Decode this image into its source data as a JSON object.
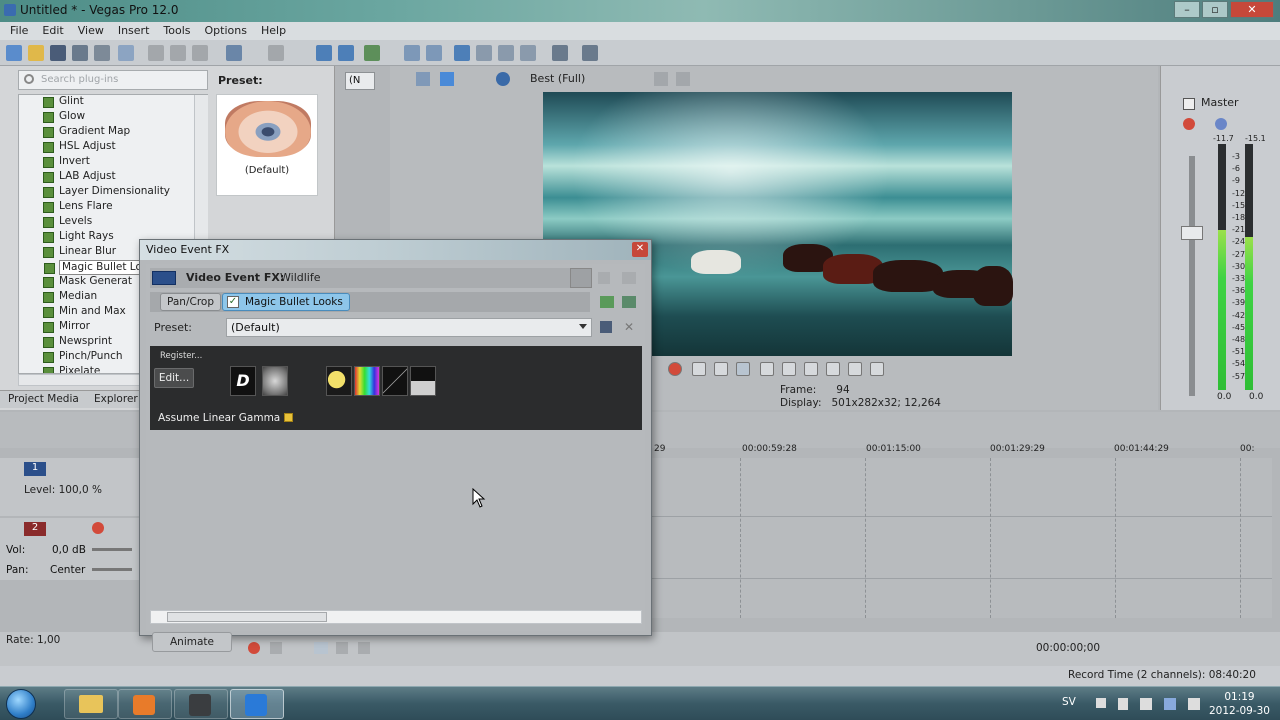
{
  "window": {
    "title": "Untitled * - Vegas Pro 12.0"
  },
  "menu": [
    "File",
    "Edit",
    "View",
    "Insert",
    "Tools",
    "Options",
    "Help"
  ],
  "plugins": {
    "search_placeholder": "Search plug-ins",
    "items": [
      "Glint",
      "Glow",
      "Gradient Map",
      "HSL Adjust",
      "Invert",
      "LAB Adjust",
      "Layer Dimensionality",
      "Lens Flare",
      "Levels",
      "Light Rays",
      "Linear Blur",
      "Magic Bullet Lo",
      "Mask Generat",
      "Median",
      "Min and Max",
      "Mirror",
      "Newsprint",
      "Pinch/Punch",
      "Pixelate"
    ],
    "selected_index": 11,
    "preset_label": "Preset:",
    "preset_caption": "(Default)"
  },
  "bottom_tabs": [
    "Project Media",
    "Explorer"
  ],
  "preview": {
    "quality": "Best (Full)",
    "frame_label": "Frame:",
    "frame_value": "94",
    "display_label": "Display:",
    "display_value": "501x282x32; 12,264",
    "mode_select": "(N"
  },
  "mixer": {
    "label": "Master",
    "peak_left": "-11.7",
    "peak_right": "-15.1",
    "scale": [
      "3",
      "6",
      "9",
      "12",
      "15",
      "18",
      "21",
      "24",
      "27",
      "30",
      "33",
      "36",
      "39",
      "42",
      "45",
      "48",
      "51",
      "54",
      "57"
    ],
    "bottom_left": "0.0",
    "bottom_right": "0.0",
    "level_left": 0.65,
    "level_right": 0.62
  },
  "timeline": {
    "ticks": [
      "29",
      "00:00:59:28",
      "00:01:15:00",
      "00:01:29:29",
      "00:01:44:29",
      "00:"
    ],
    "track1": {
      "number": "1",
      "level_label": "Level: 100,0 %"
    },
    "track2": {
      "number": "2",
      "vol_label": "Vol:",
      "vol_value": "0,0 dB",
      "pan_label": "Pan:",
      "pan_value": "Center"
    },
    "rate": "Rate: 1,00",
    "timecode": "00:00:00;00",
    "record_time": "Record Time (2 channels): 08:40:20"
  },
  "fx_dialog": {
    "title": "Video Event FX",
    "header_label": "Video Event FX:",
    "header_value": "Wildlife",
    "chain": [
      "Pan/Crop",
      "Magic Bullet Looks"
    ],
    "preset_label": "Preset:",
    "preset_value": "(Default)",
    "register_label": "Register...",
    "edit_label": "Edit...",
    "gamma_label": "Assume Linear Gamma",
    "animate_label": "Animate"
  },
  "taskbar": {
    "language": "SV",
    "time": "01:19",
    "date": "2012-09-30"
  }
}
